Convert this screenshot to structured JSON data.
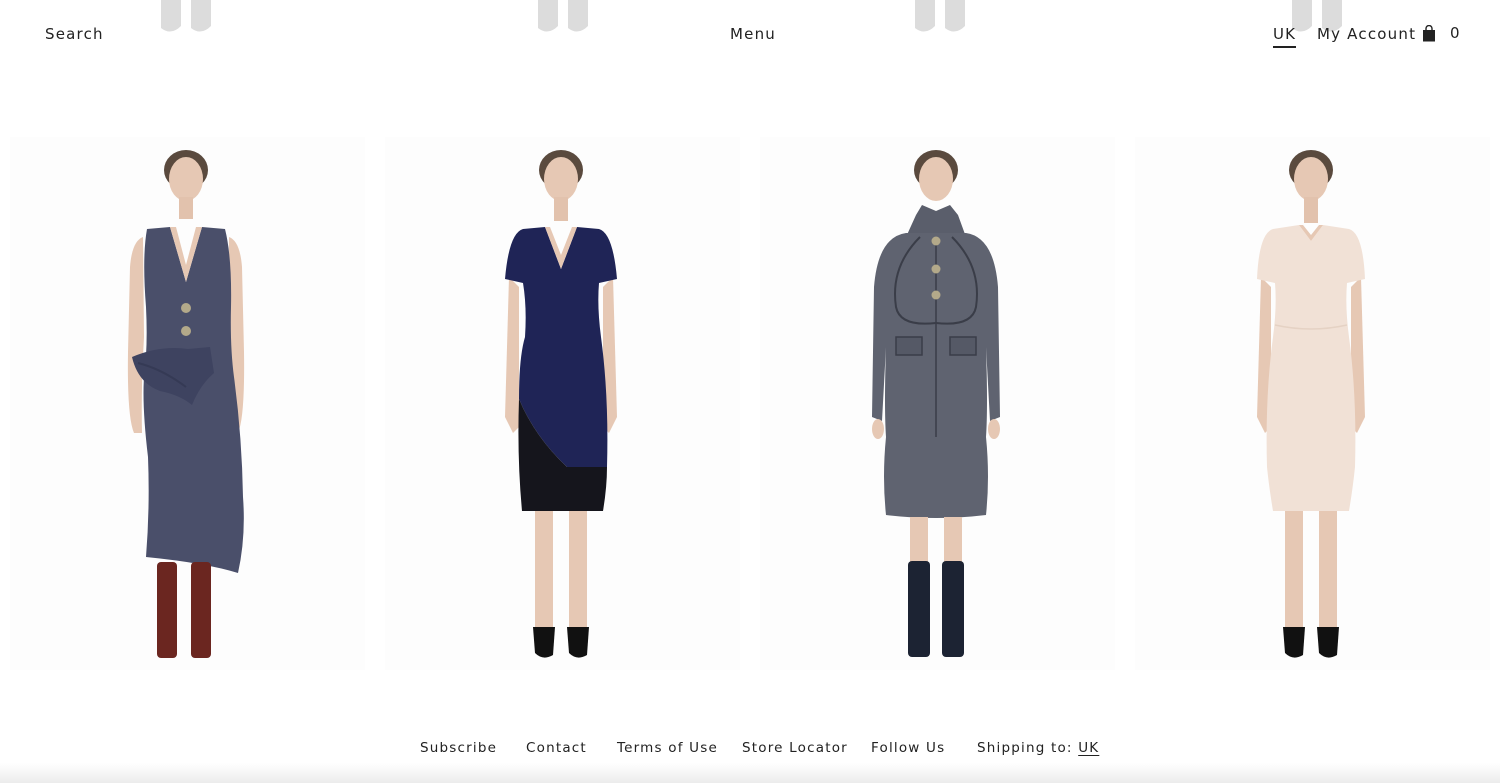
{
  "header": {
    "search_label": "Search",
    "menu_label": "Menu",
    "region_label": "UK",
    "account_label": "My Account",
    "cart_count": "0",
    "cart_icon": "shopping-bag-icon"
  },
  "products": [
    {
      "name": "product-tweed-vest-dress",
      "garment_color": "#4a4f6a",
      "shoe_color": "#6b2620",
      "style": "sleeveless midi with draped peplum"
    },
    {
      "name": "product-navy-v-neck-dress",
      "garment_color": "#1f2456",
      "shoe_color": "#111111",
      "style": "short-sleeve v-neck shift"
    },
    {
      "name": "product-grey-tweed-coat",
      "garment_color": "#5f6370",
      "shoe_color": "#1c2333",
      "style": "funnel-neck belted coat"
    },
    {
      "name": "product-blush-sheath-dress",
      "garment_color": "#f1e1d6",
      "shoe_color": "#111111",
      "style": "short-sleeve sheath"
    }
  ],
  "footer": {
    "subscribe": "Subscribe",
    "contact": "Contact",
    "terms": "Terms of Use",
    "store_locator": "Store Locator",
    "follow_us": "Follow Us",
    "shipping_prefix": "Shipping to:",
    "shipping_country": "UK"
  },
  "colors": {
    "text": "#222222",
    "background": "#ffffff",
    "skin": "#e6c8b4",
    "hair": "#5a4a3e"
  }
}
